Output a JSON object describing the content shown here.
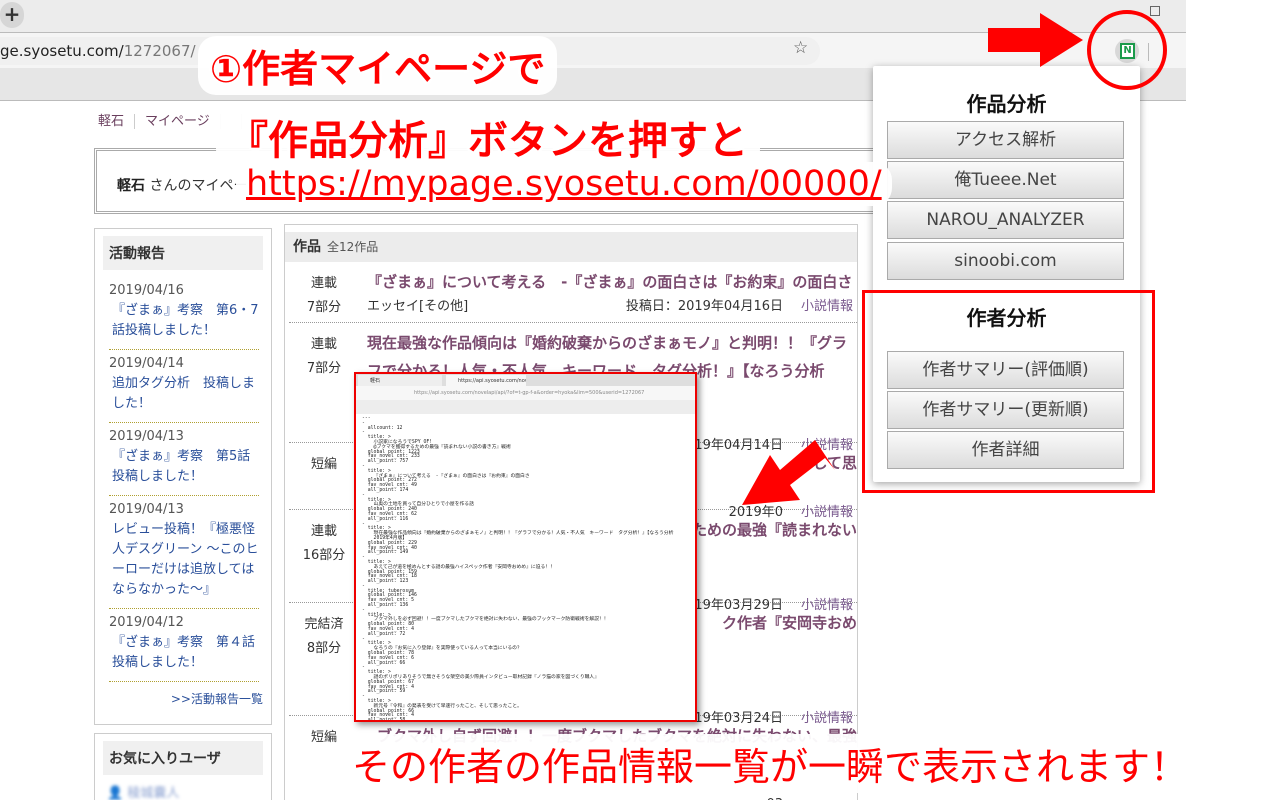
{
  "browser": {
    "new_tab": "+",
    "url_host": "ge.syosetu.com/",
    "url_path": "1272067/",
    "extension_letter": "N"
  },
  "site_nav": [
    "軽石",
    "マイページ"
  ],
  "user": {
    "name": "軽石",
    "suffix": "さんのマイペー"
  },
  "activity": {
    "title": "活動報告",
    "items": [
      {
        "date": "2019/04/16",
        "text": "『ざまぁ』考察　第6・7話投稿しました！"
      },
      {
        "date": "2019/04/14",
        "text": "追加タグ分析　投稿しました！"
      },
      {
        "date": "2019/04/13",
        "text": "『ざまぁ』考察　第5話投稿しました！"
      },
      {
        "date": "2019/04/13",
        "text": "レビュー投稿！『極悪怪人デスグリーン ～このヒーローだけは追放してはならなかった～』"
      },
      {
        "date": "2019/04/12",
        "text": "『ざまぁ』考察　第４話投稿しました！"
      }
    ],
    "more": ">>活動報告一覧"
  },
  "favorites": {
    "title": "お気に入りユーザ",
    "user": "稜城嚢人"
  },
  "works": {
    "title": "作品",
    "count": "全12作品",
    "info_label": "小説情報",
    "items": [
      {
        "kind": "連載",
        "parts": "7部分",
        "title": "『ざまぁ』について考える　-『ざまぁ』の面白さは『お約束』の面白さ",
        "genre": "エッセイ[その他]",
        "date": "投稿日：2019年04月16日"
      },
      {
        "kind": "連載",
        "parts": "7部分",
        "title": "現在最強な作品傾向は『婚約破棄からのざまぁモノ』と判明！！『グラフで分かる！人気・不人気　キーワード　タグ分析！』【なろう分析",
        "genre": "",
        "date": "2019年04月14日"
      },
      {
        "kind": "短編",
        "parts": "",
        "title": "そして思",
        "genre": "",
        "date": "2019年0"
      },
      {
        "kind": "連載",
        "parts": "16部分",
        "title": "ための最強『読まれない",
        "genre": "",
        "date": "2019年03月29日"
      },
      {
        "kind": "完結済",
        "parts": "8部分",
        "title": "ク作者『安岡寺おめ",
        "genre": "",
        "date": "2019年03月24日"
      },
      {
        "kind": "短編",
        "parts": "",
        "title": "ブクマ外し自ず回避！！一度ブクマしたブクマを絶対に失わない、最強",
        "genre": "",
        "date": "03"
      }
    ]
  },
  "popup": {
    "section1": "作品分析",
    "buttons1": [
      "アクセス解析",
      "俺Tueee.Net",
      "NAROU_ANALYZER",
      "sinoobi.com"
    ],
    "section2": "作者分析",
    "buttons2": [
      "作者サマリー(評価順)",
      "作者サマリー(更新順)",
      "作者詳細"
    ]
  },
  "inset": {
    "tab1": "軽石",
    "tab2": "https://api.syosetu.com/novelapi/...",
    "url": "https://api.syosetu.com/novelapi/api/?of=t-gp-f-a&order=hyoka&lim=500&userid=1272067",
    "body": "---\n-\n  allcount: 12\n-\n  title: >\n    小説家になろうでSPY OF!\n    @ブクマを獲得するための最強『読まれない小説の書き方』戦術\n  global_point: 1223\n  fav_novel_cnt: 233\n  all_point: 757\n-\n  title: >\n    『ざまぁ』について考える　-『ざまぁ』の面白さは『お約束』の面白さ\n  global_point: 272\n  fav_novel_cnt: 49\n  all_point: 174\n-\n  title: >\n    山奥の土地を買って自分ひとりで小屋を作る話\n  global_point: 240\n  fav_novel_cnt: 62\n  all_point: 116\n-\n  title: >\n    現在最強な作品傾向は『婚約破棄からのざまぁモノ』と判明！！『グラフで分かる！人気・不人気　キーワード　タグ分析！』【なろう分析\n    2019年4月版】\n  global_point: 229\n  fav_novel_cnt: 40\n  all_point: 149\n-\n  title: >\n    あえて己が道を極めんとする謎の最強ハイスペック作者『安岡寺おめめ』に迫る！！\n  global_point: 159\n  fav_novel_cnt: 18\n  all_point: 123\n-\n  title: tuberosum\n  global_point: 146\n  fav_novel_cnt: 5\n  all_point: 136\n-\n  title: >\n    ブクマ外しを必ず回避！！一度ブクマしたブクマを絶対に失わない、最強のブックマーク防衛戦術を解説！！\n  global_point: 80\n  fav_novel_cnt: 4\n  all_point: 72\n-\n  title: >\n    なろうの『お気に入り登録』を実際使っている人って本当にいるの？\n  global_point: 78\n  fav_novel_cnt: 6\n  all_point: 66\n-\n  title: >\n    謎のポリポリありそうで無さそうな架空の美少際員インタビュー取材記録『ノラ猫の家を図づくり職人』\n  global_point: 67\n  fav_novel_cnt: 4\n  all_point: 59\n-\n  title: >\n    新元号『令和』の発表を受けて早速行ったこと、そして思ったこと。\n  global_point: 66\n  fav_novel_cnt: 4\n  all_point: 58\n-"
  },
  "annotations": {
    "line1": "①作者マイページで",
    "line2": "『作品分析』ボタンを押すと",
    "url": "https://mypage.syosetu.com/00000/",
    "bottom": "その作者の作品情報一覧が一瞬で表示されます！"
  },
  "colors": {
    "annotation": "#ff0000",
    "link": "#2a4f9a",
    "work_title": "#7a4a6e"
  }
}
